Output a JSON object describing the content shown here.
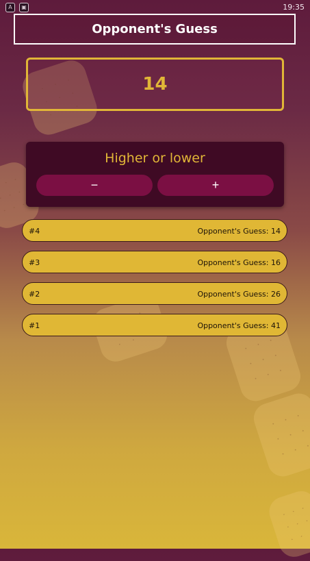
{
  "status_bar": {
    "time": "19:35",
    "icons": [
      "app-icon",
      "sim-icon"
    ],
    "icon_glyphs": [
      "A",
      "▣"
    ]
  },
  "header": {
    "title": "Opponent's Guess"
  },
  "current_guess": {
    "value": "14"
  },
  "hint_card": {
    "title": "Higher or lower",
    "minus_label": "−",
    "plus_label": "+"
  },
  "log": [
    {
      "round": "#4",
      "text": "Opponent's Guess: 14"
    },
    {
      "round": "#3",
      "text": "Opponent's Guess: 16"
    },
    {
      "round": "#2",
      "text": "Opponent's Guess: 26"
    },
    {
      "round": "#1",
      "text": "Opponent's Guess: 41"
    }
  ],
  "colors": {
    "accent": "#e1b637",
    "button": "#7b0f43",
    "card": "#3f0a24"
  }
}
